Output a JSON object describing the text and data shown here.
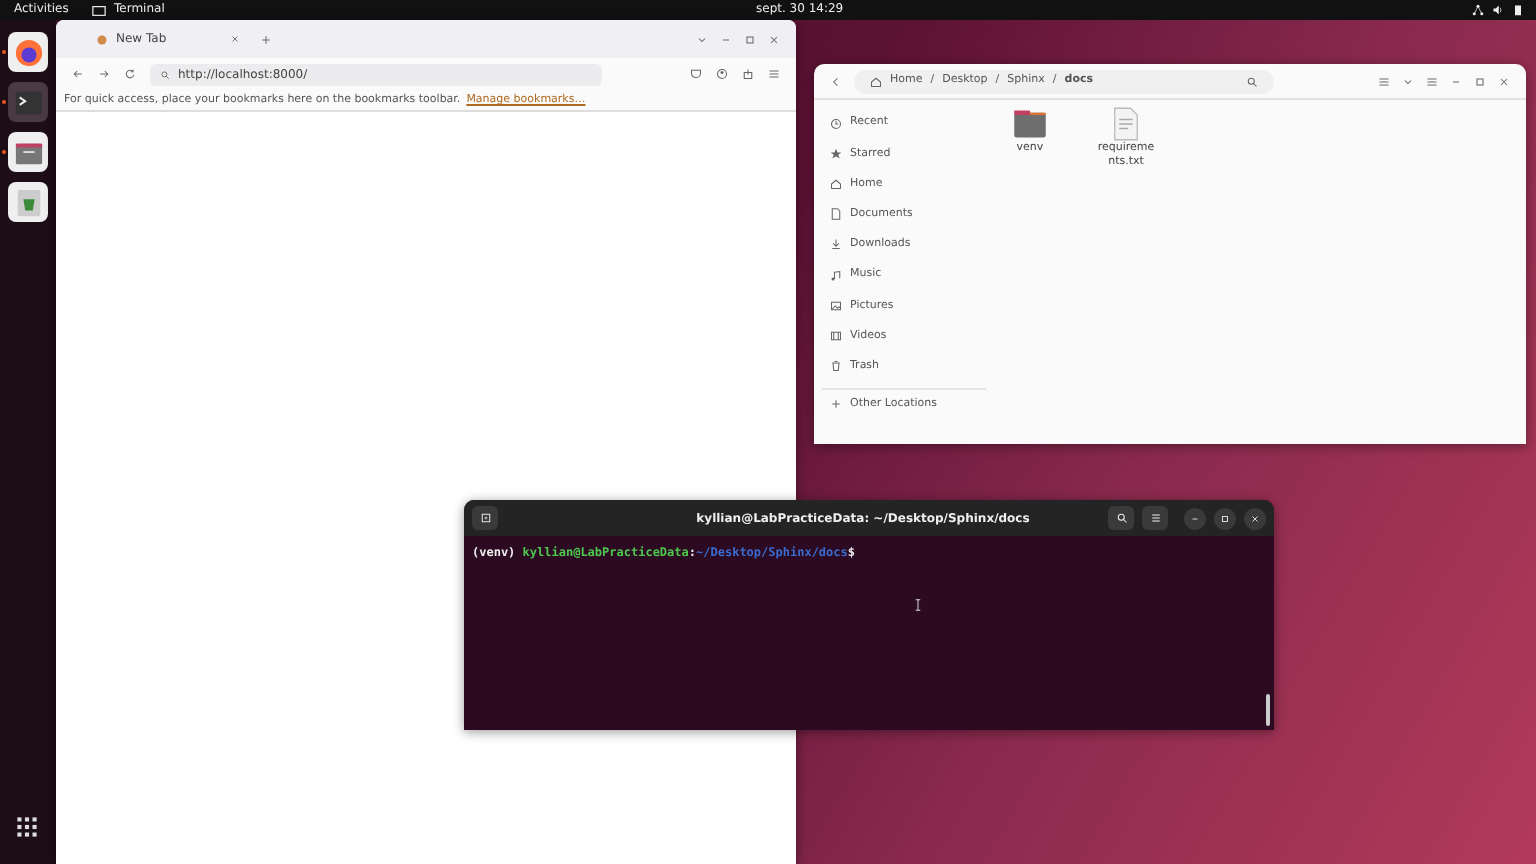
{
  "top_bar": {
    "activities": "Activities",
    "app": "Terminal",
    "clock": "sept. 30  14:29"
  },
  "dock": {
    "items": [
      {
        "kind": "browser",
        "running": true,
        "selected": false
      },
      {
        "kind": "terminal",
        "running": true,
        "selected": true
      },
      {
        "kind": "files",
        "running": true,
        "selected": false
      },
      {
        "kind": "trash",
        "running": false,
        "selected": false
      }
    ]
  },
  "browser": {
    "tab_title": "New Tab",
    "url": "http://localhost:8000/",
    "bookmarks_hint": "For quick access, place your bookmarks here on the bookmarks toolbar.",
    "bookmarks_link": "Manage bookmarks…"
  },
  "files": {
    "path": [
      "Home",
      "Desktop",
      "Sphinx",
      "docs"
    ],
    "path_separator": "/",
    "sidebar": [
      {
        "kind": "recent",
        "label": "Recent"
      },
      {
        "kind": "starred",
        "label": "Starred"
      },
      {
        "kind": "home",
        "label": "Home"
      },
      {
        "kind": "documents",
        "label": "Documents"
      },
      {
        "kind": "downloads",
        "label": "Downloads"
      },
      {
        "kind": "music",
        "label": "Music"
      },
      {
        "kind": "pictures",
        "label": "Pictures"
      },
      {
        "kind": "videos",
        "label": "Videos"
      },
      {
        "kind": "trash",
        "label": "Trash"
      },
      {
        "kind": "other",
        "label": "Other Locations"
      }
    ],
    "items": [
      {
        "kind": "folder",
        "name": "venv"
      },
      {
        "kind": "text",
        "name": "requirements.txt"
      }
    ]
  },
  "terminal": {
    "title": "kyllian@LabPracticeData: ~/Desktop/Sphinx/docs",
    "env": "(venv)",
    "user": "kyllian@LabPracticeData",
    "separator": ":",
    "cwd": "~/Desktop/Sphinx/docs",
    "symbol": "$"
  }
}
